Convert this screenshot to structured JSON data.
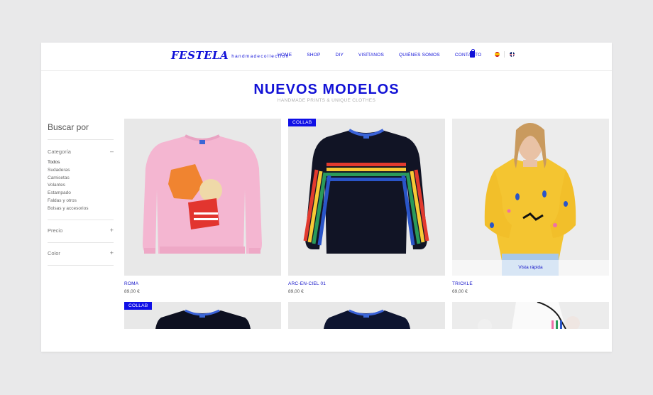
{
  "brand": {
    "name": "FESTELA",
    "tagline": "handmadecollection"
  },
  "nav": [
    "HOME",
    "SHOP",
    "DIY",
    "VISÍTANOS",
    "QUIÉNES SOMOS",
    "CONTACTO"
  ],
  "header": {
    "title": "NUEVOS MODELOS",
    "subtitle": "HANDMADE PRINTS & UNIQUE CLOTHES"
  },
  "sidebar": {
    "title": "Buscar por",
    "sections": [
      {
        "label": "Categoría",
        "toggle": "–",
        "items": [
          "Todos",
          "Sudaderas",
          "Camisetas",
          "Volantes",
          "Estampado",
          "Faldas y otros",
          "Bolsas y accesorios"
        ]
      },
      {
        "label": "Precio",
        "toggle": "+"
      },
      {
        "label": "Color",
        "toggle": "+"
      }
    ]
  },
  "products": [
    {
      "name": "ROMA",
      "price": "89,00 €"
    },
    {
      "name": "ARC-EN-CIEL 01",
      "price": "89,00 €",
      "badge": "COLLAB"
    },
    {
      "name": "TRICKLE",
      "price": "69,00 €",
      "quick_view": "Vista rápida"
    },
    {
      "badge": "COLLAB"
    }
  ],
  "colors": {
    "accent": "#1010d8",
    "pink": "#f4b6d1",
    "yellow": "#f4c531",
    "navy": "#0e1530"
  }
}
